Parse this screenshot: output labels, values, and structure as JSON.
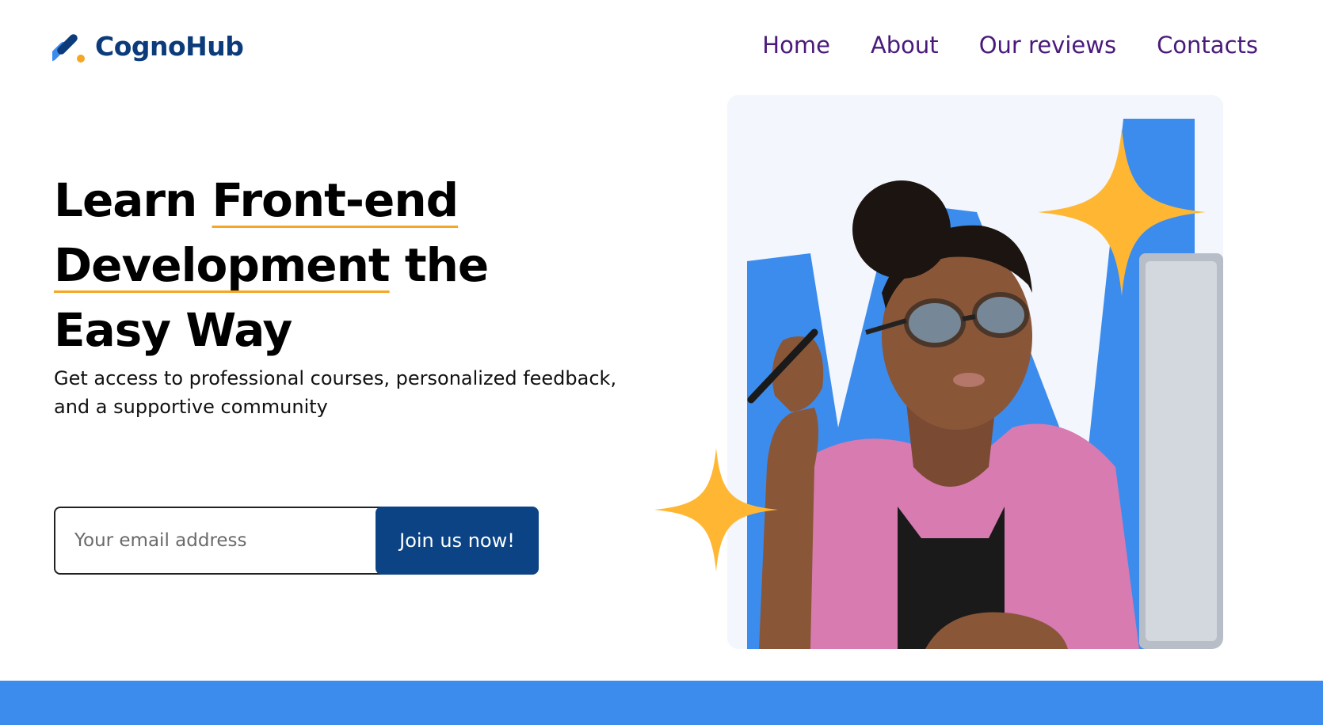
{
  "brand": {
    "name": "CognoHub",
    "logo_icon": "slash-dot-logo-icon",
    "primary_color": "#0b3b7a",
    "accent_color": "#f5a623"
  },
  "nav": {
    "items": [
      {
        "label": "Home"
      },
      {
        "label": "About"
      },
      {
        "label": "Our reviews"
      },
      {
        "label": "Contacts"
      }
    ],
    "color": "#4a1a7a"
  },
  "hero": {
    "title_part1": "Learn ",
    "title_highlight1": "Front-end",
    "title_highlight2": "Development",
    "title_part2": " the Easy Way",
    "subtitle": "Get access to professional courses, personalized feedback, and a supportive community"
  },
  "signup": {
    "email_placeholder": "Your email address",
    "email_value": "",
    "button_label": "Join us now!",
    "button_color": "#0b4385"
  },
  "illustration": {
    "subject": "woman-with-glasses-at-computer",
    "background_shape_color": "#3c8ced",
    "star_color": "#ffb733"
  },
  "footer_band_color": "#3c8ced"
}
